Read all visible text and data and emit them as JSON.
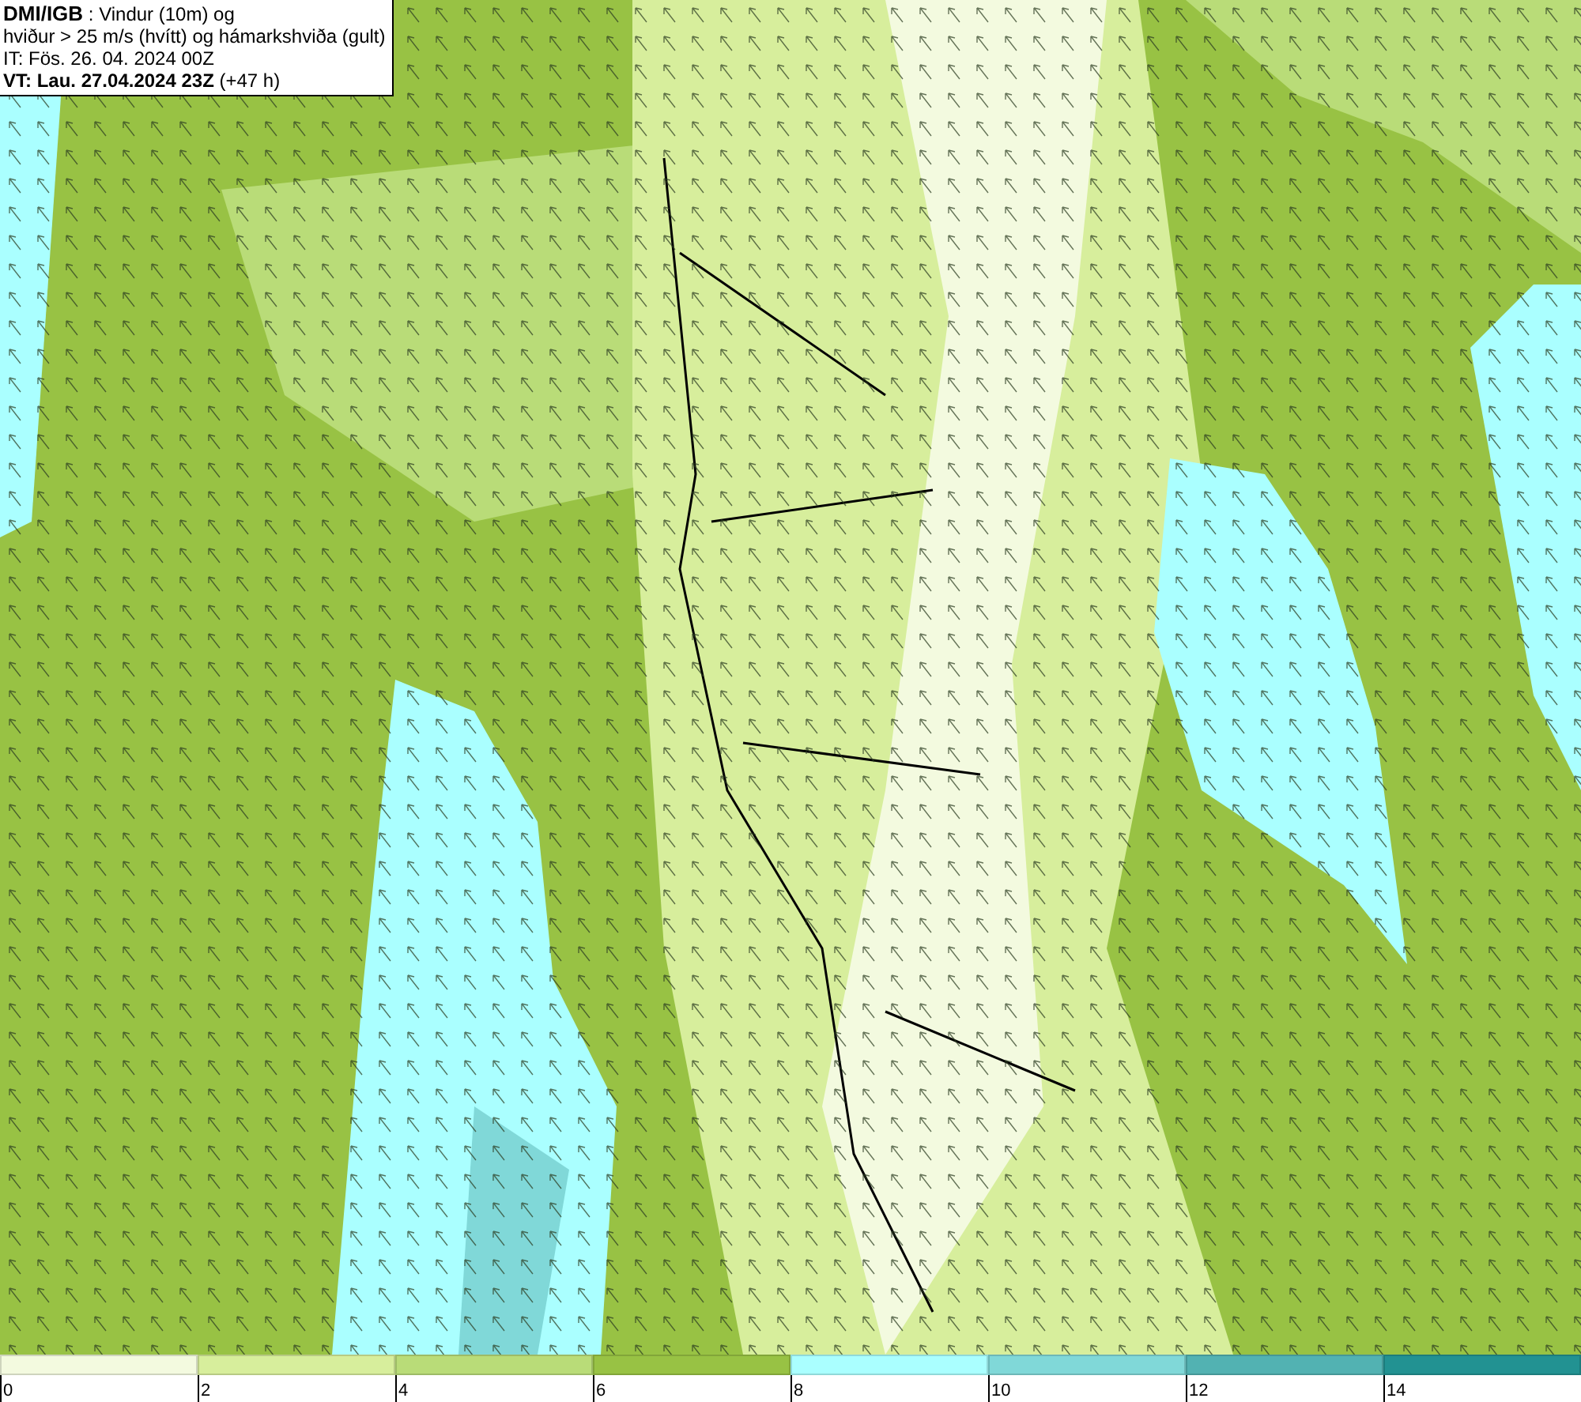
{
  "title_box": {
    "source": "DMI/IGB",
    "description": " : Vindur (10m) og",
    "line_2": "hviður > 25 m/s (hvítt) og hámarkshviða (gult)",
    "issue_time": "IT: Fös. 26. 04. 2024 00Z",
    "valid_time": "VT: Lau. 27.04.2024 23Z",
    "lead_time": " (+47 h)"
  },
  "legend": {
    "bins": [
      {
        "color": "#f3fadf"
      },
      {
        "color": "#d7ee9c"
      },
      {
        "color": "#b9dc78"
      },
      {
        "color": "#98c244"
      },
      {
        "color": "#aaffff"
      },
      {
        "color": "#80d8d8"
      },
      {
        "color": "#52b2b2"
      },
      {
        "color": "#229292"
      }
    ],
    "ticks": [
      "0",
      "2",
      "4",
      "6",
      "8",
      "10",
      "12",
      "14"
    ]
  }
}
